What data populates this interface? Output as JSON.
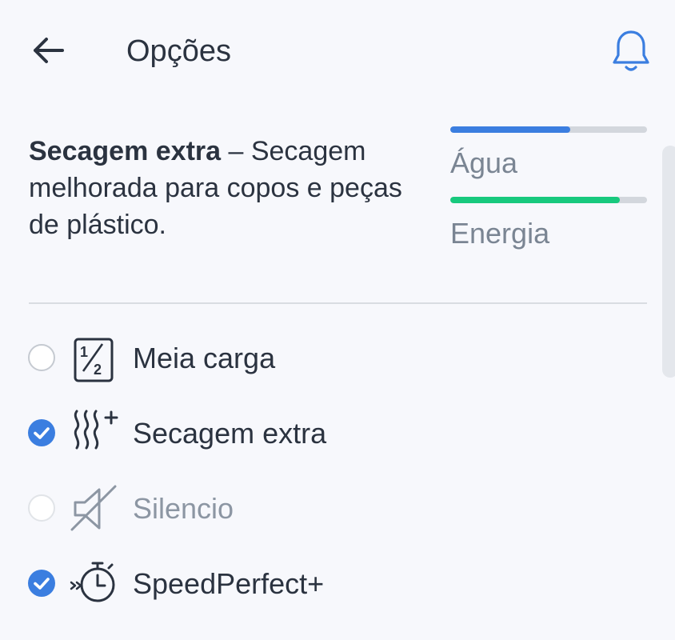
{
  "header": {
    "title": "Opções"
  },
  "description": {
    "bold": "Secagem extra",
    "rest": " – Secagem melhorada para copos e peças de plástico."
  },
  "meters": {
    "water": {
      "label": "Água",
      "fill_fraction": 0.61,
      "color": "#3b7ee0"
    },
    "energy": {
      "label": "Energia",
      "fill_fraction": 0.86,
      "color": "#18c97e"
    }
  },
  "options": [
    {
      "label": "Meia carga",
      "checked": false,
      "enabled": true,
      "icon": "half-load-icon"
    },
    {
      "label": "Secagem extra",
      "checked": true,
      "enabled": true,
      "icon": "extra-dry-icon"
    },
    {
      "label": "Silencio",
      "checked": false,
      "enabled": false,
      "icon": "silence-icon"
    },
    {
      "label": "SpeedPerfect+",
      "checked": true,
      "enabled": true,
      "icon": "speed-perfect-icon"
    }
  ],
  "colors": {
    "accent": "#3b7ee0",
    "energy": "#18c97e",
    "text": "#2b3340",
    "muted": "#8c96a3",
    "background": "#f7f8fc"
  }
}
